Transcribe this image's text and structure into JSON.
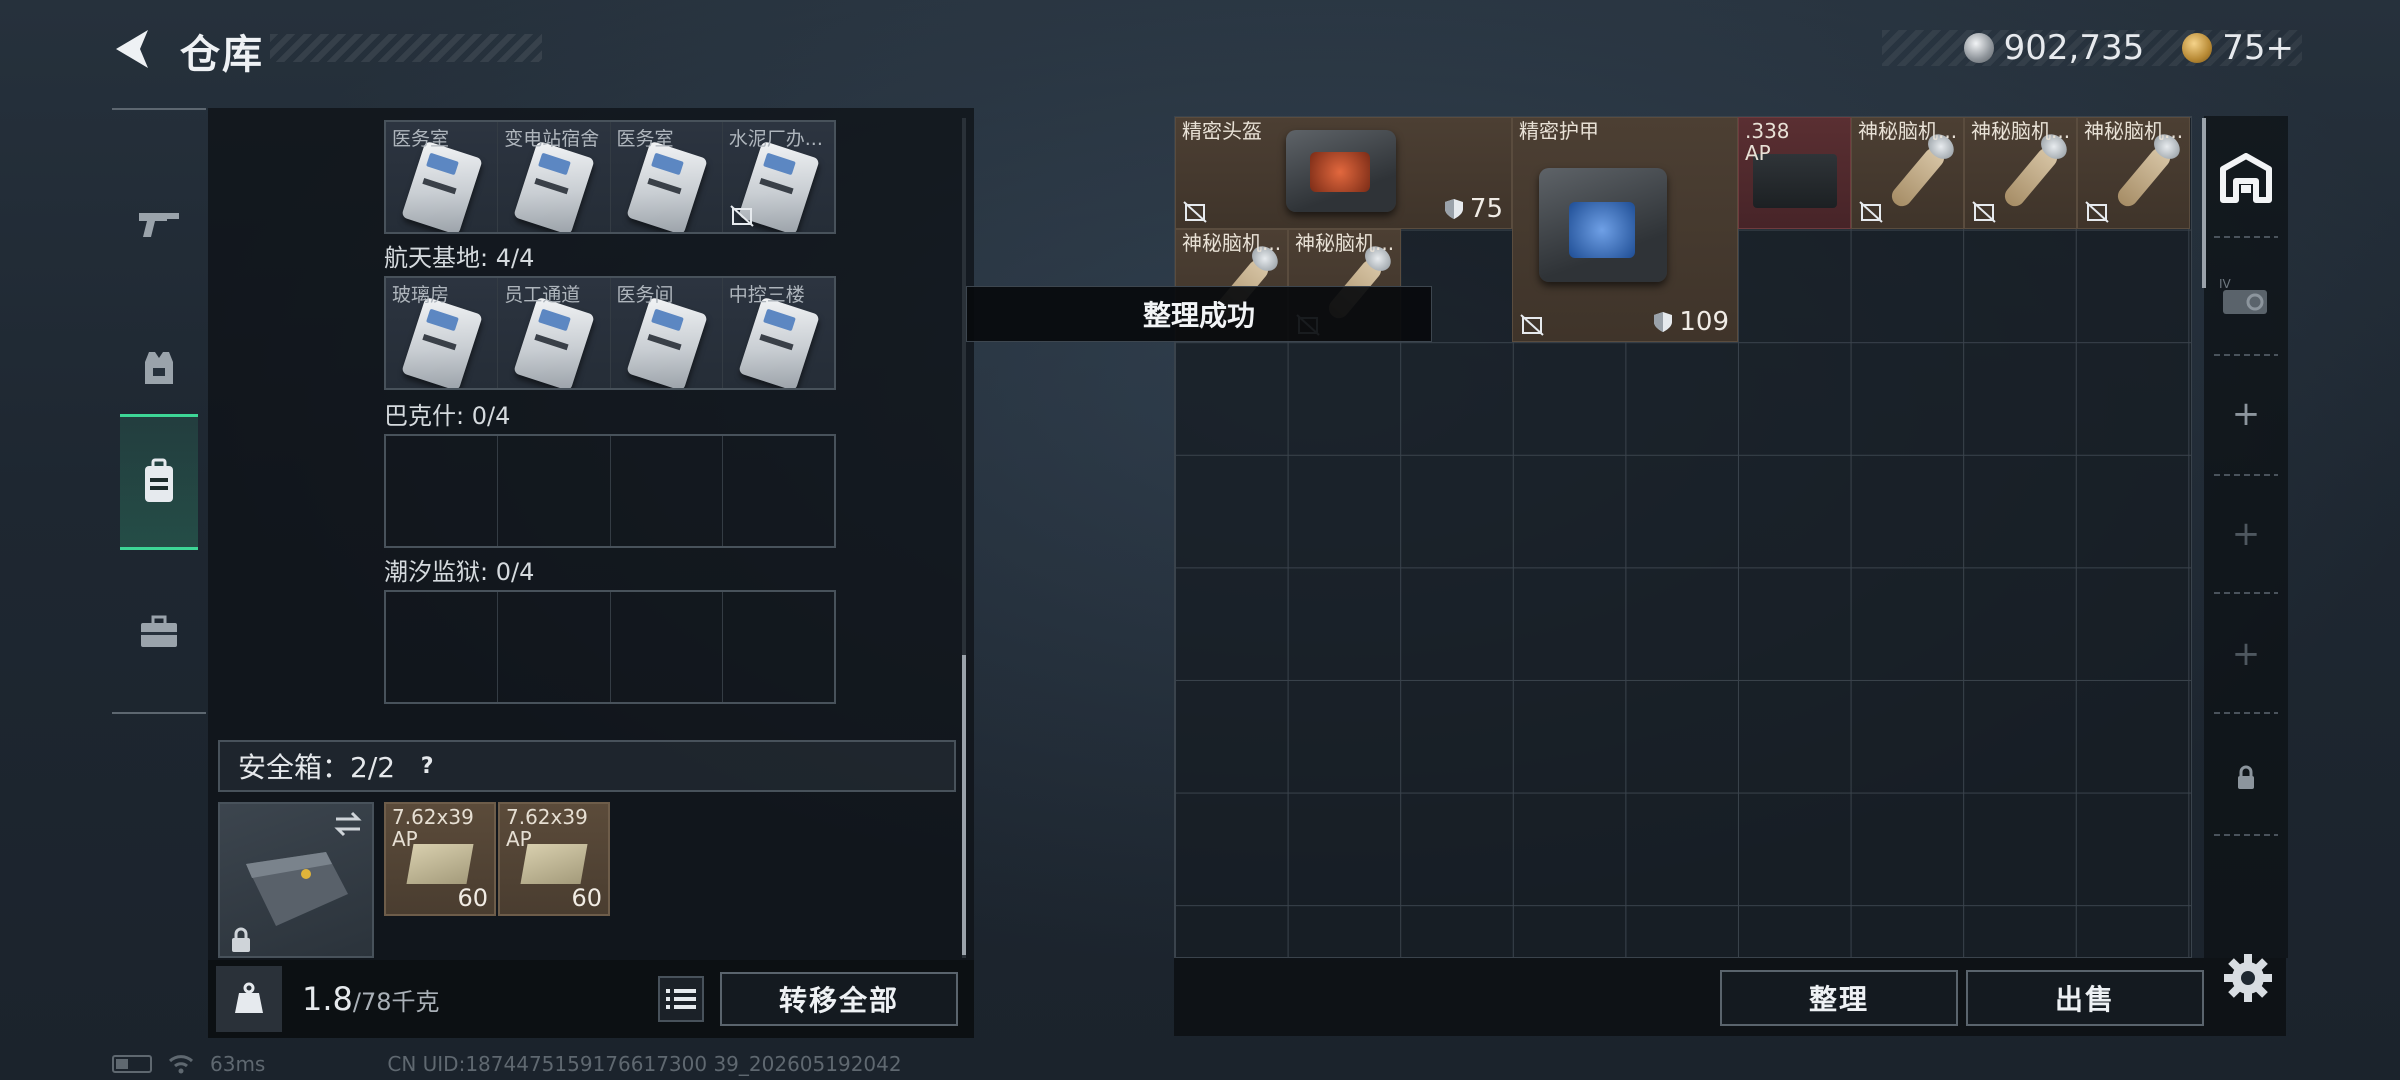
{
  "header": {
    "title": "仓库",
    "currency_silver": "902,735",
    "currency_gold": "75+"
  },
  "nav": {
    "items": [
      {
        "icon": "gun-icon"
      },
      {
        "icon": "vest-icon"
      },
      {
        "icon": "backpack-icon",
        "active": true
      },
      {
        "icon": "toolbox-icon"
      }
    ]
  },
  "keycard_rows": [
    {
      "label": "",
      "cards": [
        "医务室",
        "变电站宿舍",
        "医务室",
        "水泥厂办..."
      ]
    },
    {
      "label": "航天基地: 4/4",
      "cards": [
        "玻璃房",
        "员工通道",
        "医务间",
        "中控三楼"
      ]
    },
    {
      "label": "巴克什: 0/4",
      "cards": []
    },
    {
      "label": "潮汐监狱: 0/4",
      "cards": []
    }
  ],
  "safe": {
    "label": "安全箱：2/2",
    "help": "?",
    "ammo": [
      {
        "name": "7.62x39\nAP",
        "count": "60"
      },
      {
        "name": "7.62x39\nAP",
        "count": "60"
      }
    ]
  },
  "bottom_left": {
    "weight": "1.8",
    "weight_max": "/78千克",
    "transfer_all": "转移全部"
  },
  "stash_items": [
    {
      "name": "精密头盔",
      "value": "75"
    },
    {
      "name": "精密护甲",
      "value": "109"
    },
    {
      "name": ".338\nAP"
    },
    {
      "name": "神秘脑机..."
    },
    {
      "name": "神秘脑机..."
    },
    {
      "name": "神秘脑机..."
    },
    {
      "name": "神秘脑机..."
    },
    {
      "name": "神秘脑机..."
    }
  ],
  "toast": "整理成功",
  "bottom_right": {
    "organize": "整理",
    "sell": "出售"
  },
  "status": {
    "ping": "63ms",
    "uid": "CN UID:1874475159176617300 39_202605192042"
  },
  "colors": {
    "accent_green": "#3dd696",
    "item_brown": "#4c3f33",
    "item_red": "#5a2f32"
  }
}
